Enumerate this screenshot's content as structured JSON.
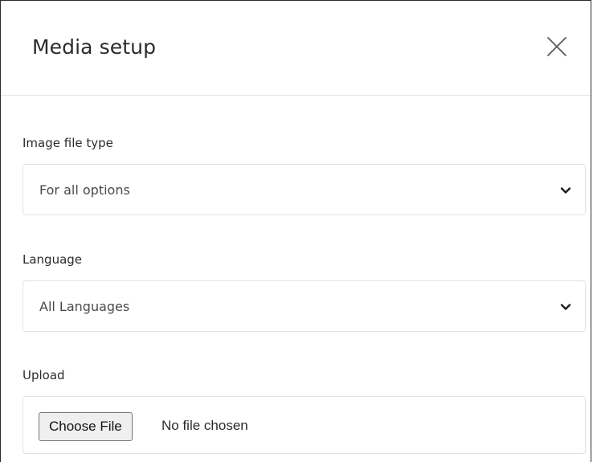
{
  "modal": {
    "title": "Media setup"
  },
  "fields": {
    "image_file_type": {
      "label": "Image file type",
      "selected": "For all options"
    },
    "language": {
      "label": "Language",
      "selected": "All Languages"
    },
    "upload": {
      "label": "Upload",
      "button_label": "Choose File",
      "status": "No file chosen"
    }
  },
  "icons": {
    "close": "close-icon",
    "chevron": "chevron-down-icon"
  }
}
